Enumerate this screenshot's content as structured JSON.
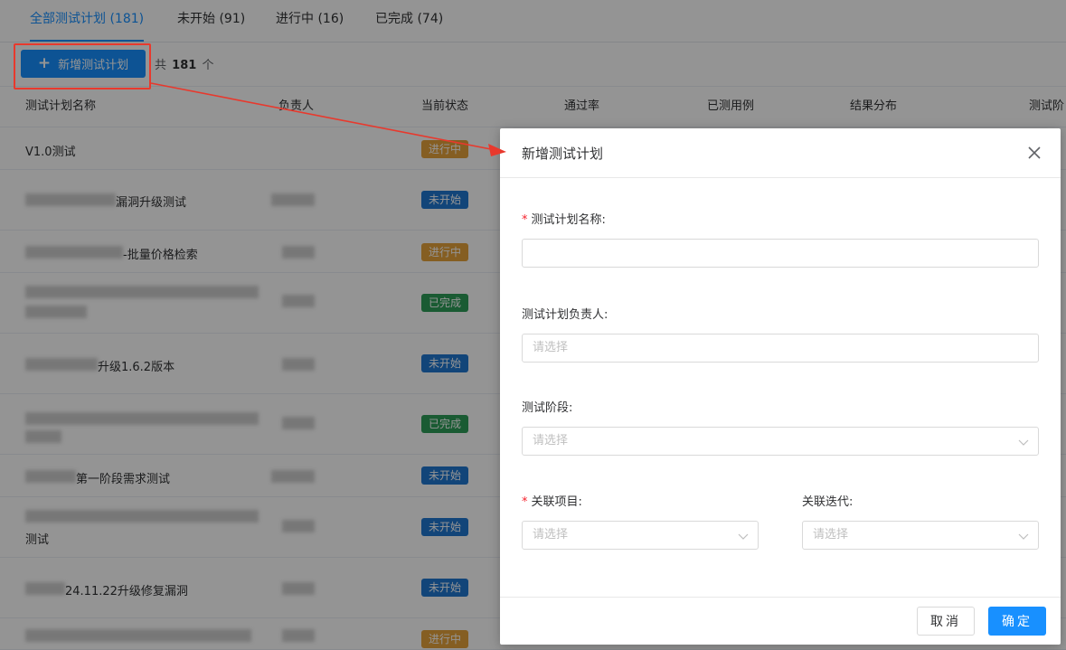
{
  "tabs": [
    {
      "label": "全部测试计划 (181)"
    },
    {
      "label": "未开始 (91)"
    },
    {
      "label": "进行中 (16)"
    },
    {
      "label": "已完成 (74)"
    }
  ],
  "toolbar": {
    "add_label": "新增测试计划",
    "total_prefix": "共",
    "total_count": "181",
    "total_suffix": "个"
  },
  "table": {
    "headers": [
      "测试计划名称",
      "负责人",
      "当前状态",
      "通过率",
      "已测用例",
      "结果分布",
      "测试阶"
    ],
    "rows": [
      {
        "name": "V1.0测试",
        "status": "进行中"
      },
      {
        "name": "漏洞升级测试",
        "status": "未开始"
      },
      {
        "name": "-批量价格检索",
        "status": "进行中"
      },
      {
        "name": "",
        "status": "已完成"
      },
      {
        "name": "升级1.6.2版本",
        "status": "未开始"
      },
      {
        "name": "",
        "status": "已完成"
      },
      {
        "name": "第一阶段需求测试",
        "status": "未开始"
      },
      {
        "name": "测试",
        "status": "未开始"
      },
      {
        "name": "24.11.22升级修复漏洞",
        "status": "未开始"
      },
      {
        "name": "",
        "status": "进行中"
      }
    ]
  },
  "dialog": {
    "title": "新增测试计划",
    "name_label": "测试计划名称:",
    "owner_label": "测试计划负责人:",
    "owner_placeholder": "请选择",
    "stage_label": "测试阶段:",
    "stage_placeholder": "请选择",
    "project_label": "关联项目:",
    "project_placeholder": "请选择",
    "iteration_label": "关联迭代:",
    "iteration_placeholder": "请选择",
    "cancel_label": "取消",
    "ok_label": "确定"
  },
  "colors": {
    "primary": "#1890ff",
    "annotation": "#e8392d",
    "status_progress": "#e6a23c",
    "status_pending": "#1f78d1",
    "status_done": "#2e9d58"
  }
}
